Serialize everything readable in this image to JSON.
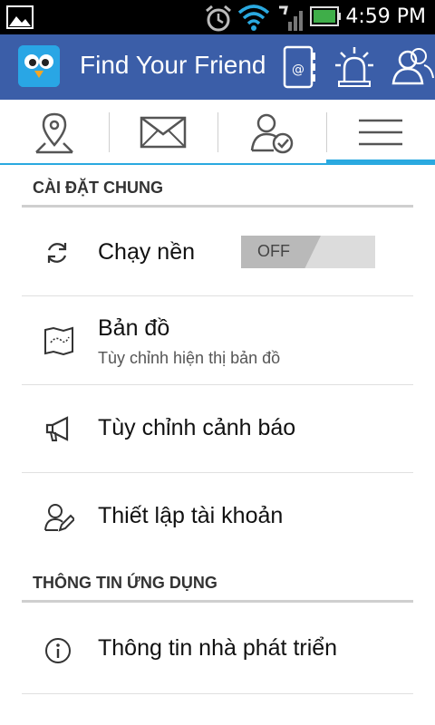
{
  "status_bar": {
    "time": "4:59 PM",
    "icons": [
      "gallery-icon",
      "alarm-icon",
      "wifi-icon",
      "signal-icon",
      "battery-icon"
    ]
  },
  "app_bar": {
    "title": "Find Your Friend",
    "logo": "bird-logo",
    "actions": [
      "contact-book-icon",
      "alarm-siren-icon",
      "friends-icon"
    ],
    "color": "#3b5ea8"
  },
  "tabs": [
    {
      "name": "map-location",
      "icon": "location-pin-icon"
    },
    {
      "name": "messages",
      "icon": "envelope-icon"
    },
    {
      "name": "friends-verified",
      "icon": "user-check-icon"
    },
    {
      "name": "menu",
      "icon": "menu-icon",
      "active": true
    }
  ],
  "sections": {
    "general": {
      "title": "CÀI ĐẶT CHUNG",
      "items": [
        {
          "label": "Chạy nền",
          "icon": "sync-icon",
          "toggle": "OFF"
        },
        {
          "label": "Bản đồ",
          "subtitle": "Tùy chỉnh hiện thị bản đồ",
          "icon": "map-icon"
        },
        {
          "label": "Tùy chỉnh cảnh báo",
          "icon": "megaphone-icon"
        },
        {
          "label": "Thiết lập tài khoản",
          "icon": "user-edit-icon"
        }
      ]
    },
    "app_info": {
      "title": "THÔNG TIN ỨNG DỤNG",
      "items": [
        {
          "label": "Thông tin nhà phát triển",
          "icon": "info-icon"
        }
      ]
    }
  },
  "accent_color": "#2aa9e0"
}
